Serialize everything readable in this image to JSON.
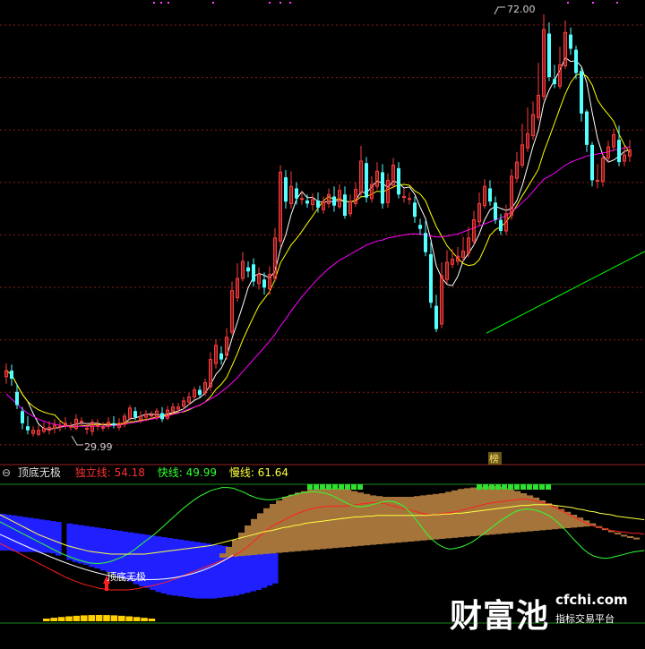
{
  "price_panel": {
    "high_label": "72.00",
    "low_label": "29.99",
    "bang_label": "榜"
  },
  "indicator": {
    "name": "顶底无极",
    "indep_label": "独立线: 54.18",
    "fast_label": "快线: 49.99",
    "slow_label": "慢线: 61.64",
    "signal_text": "顶底无极"
  },
  "watermark": {
    "brand": "财富池",
    "url": "cfchi.com",
    "tagline": "指标交易平台"
  },
  "colors": {
    "background": "#000000",
    "up_candle": "#ff3c3c",
    "down_candle": "#54ffff",
    "ma5": "#ffffff",
    "ma10": "#ffff00",
    "ma20": "#ff00ff",
    "ma60": "#00ff00",
    "blue_fill": "#2020ff",
    "brown_fill": "#a5743a",
    "indep_line": "#ff2020",
    "fast_line": "#30ff30",
    "slow_line": "#ffff40"
  },
  "chart_data": {
    "type": "candlestick",
    "y_high": 72.0,
    "y_low": 29.99,
    "candles": [
      [
        36.2,
        36.8,
        37.5,
        35.5
      ],
      [
        36.8,
        36.0,
        37.4,
        35.3
      ],
      [
        34.7,
        33.4,
        35.5,
        33.0
      ],
      [
        32.8,
        31.6,
        33.2,
        31.0
      ],
      [
        31.3,
        30.9,
        32.3,
        30.5
      ],
      [
        30.6,
        30.9,
        31.3,
        30.3
      ],
      [
        30.5,
        30.9,
        31.4,
        30.3
      ],
      [
        30.8,
        31.1,
        31.7,
        30.6
      ],
      [
        30.9,
        31.2,
        31.8,
        30.5
      ],
      [
        31.1,
        31.4,
        32.0,
        30.6
      ],
      [
        31.3,
        31.3,
        31.9,
        30.8
      ],
      [
        31.4,
        31.6,
        32.2,
        31.0
      ],
      [
        31.3,
        31.3,
        31.7,
        30.9
      ],
      [
        31.1,
        32.0,
        32.5,
        30.9
      ],
      [
        31.7,
        31.8,
        32.2,
        31.3
      ],
      [
        31.1,
        31.1,
        31.6,
        30.5
      ],
      [
        30.8,
        31.7,
        32.0,
        30.4
      ],
      [
        31.4,
        31.4,
        32.0,
        30.9
      ],
      [
        31.2,
        31.2,
        31.7,
        30.8
      ],
      [
        31.3,
        31.7,
        32.2,
        31.0
      ],
      [
        31.6,
        31.4,
        32.3,
        31.1
      ],
      [
        31.2,
        31.6,
        32.1,
        30.9
      ],
      [
        31.5,
        32.3,
        32.6,
        31.2
      ],
      [
        32.1,
        33.1,
        33.4,
        31.9
      ],
      [
        32.8,
        32.2,
        33.2,
        31.9
      ],
      [
        32.0,
        32.3,
        32.8,
        31.6
      ],
      [
        32.2,
        32.5,
        32.9,
        31.8
      ],
      [
        32.4,
        32.4,
        32.8,
        32.0
      ],
      [
        32.2,
        32.8,
        33.1,
        31.9
      ],
      [
        32.6,
        32.0,
        33.2,
        31.7
      ],
      [
        32.1,
        32.9,
        33.3,
        31.9
      ],
      [
        32.8,
        33.2,
        33.6,
        32.4
      ],
      [
        33.0,
        33.2,
        33.6,
        32.7
      ],
      [
        33.3,
        33.8,
        34.2,
        33.0
      ],
      [
        33.7,
        34.2,
        34.6,
        33.4
      ],
      [
        34.2,
        34.9,
        35.2,
        33.9
      ],
      [
        34.9,
        34.4,
        35.3,
        34.1
      ],
      [
        34.6,
        35.6,
        36.0,
        34.3
      ],
      [
        35.2,
        37.9,
        38.6,
        34.8
      ],
      [
        37.5,
        39.3,
        39.9,
        37.0
      ],
      [
        38.5,
        37.9,
        39.2,
        37.4
      ],
      [
        38.3,
        40.1,
        41.0,
        37.9
      ],
      [
        40.6,
        44.7,
        45.6,
        40.3
      ],
      [
        44.0,
        45.9,
        47.4,
        43.6
      ],
      [
        45.9,
        47.6,
        48.5,
        45.6
      ],
      [
        47.0,
        46.6,
        47.6,
        46.0
      ],
      [
        47.3,
        45.6,
        47.9,
        45.1
      ],
      [
        45.4,
        46.3,
        47.0,
        44.8
      ],
      [
        45.8,
        45.0,
        46.5,
        44.3
      ],
      [
        44.9,
        46.3,
        47.1,
        44.3
      ],
      [
        45.9,
        49.9,
        50.9,
        45.6
      ],
      [
        49.6,
        56.4,
        57.1,
        49.0
      ],
      [
        55.9,
        53.5,
        56.6,
        52.8
      ],
      [
        53.3,
        55.0,
        56.5,
        52.8
      ],
      [
        54.8,
        53.8,
        55.4,
        53.2
      ],
      [
        53.8,
        53.8,
        54.5,
        53.2
      ],
      [
        53.6,
        53.3,
        54.2,
        52.9
      ],
      [
        53.2,
        53.7,
        54.3,
        52.6
      ],
      [
        53.6,
        52.9,
        54.4,
        52.4
      ],
      [
        52.7,
        53.5,
        54.0,
        52.3
      ],
      [
        53.3,
        54.2,
        54.8,
        52.9
      ],
      [
        54.0,
        53.1,
        55.0,
        52.5
      ],
      [
        53.0,
        54.6,
        55.2,
        52.8
      ],
      [
        54.2,
        52.1,
        55.0,
        51.8
      ],
      [
        52.3,
        53.5,
        54.2,
        52.0
      ],
      [
        53.3,
        54.7,
        55.4,
        53.0
      ],
      [
        54.4,
        57.5,
        59.0,
        54.0
      ],
      [
        57.3,
        53.9,
        57.9,
        53.4
      ],
      [
        53.8,
        55.2,
        56.0,
        53.4
      ],
      [
        55.0,
        56.5,
        57.4,
        54.7
      ],
      [
        56.4,
        53.3,
        57.2,
        52.8
      ],
      [
        53.4,
        55.6,
        56.3,
        52.9
      ],
      [
        55.1,
        57.1,
        57.8,
        54.8
      ],
      [
        56.8,
        54.2,
        57.4,
        53.8
      ],
      [
        54.0,
        54.0,
        54.8,
        53.4
      ],
      [
        53.8,
        53.8,
        54.4,
        53.2
      ],
      [
        53.4,
        52.0,
        54.0,
        51.4
      ],
      [
        51.2,
        50.8,
        51.8,
        50.2
      ],
      [
        50.4,
        48.5,
        51.6,
        48.1
      ],
      [
        48.3,
        43.5,
        49.5,
        43.0
      ],
      [
        43.2,
        40.9,
        44.3,
        40.6
      ],
      [
        41.4,
        46.2,
        47.5,
        41.0
      ],
      [
        45.8,
        47.5,
        48.7,
        45.4
      ],
      [
        47.3,
        47.8,
        48.8,
        46.9
      ],
      [
        47.6,
        48.1,
        49.0,
        47.2
      ],
      [
        48.0,
        48.6,
        50.0,
        47.6
      ],
      [
        48.4,
        49.9,
        51.0,
        48.0
      ],
      [
        49.6,
        51.7,
        52.6,
        49.2
      ],
      [
        51.5,
        53.3,
        54.4,
        51.1
      ],
      [
        53.1,
        55.0,
        55.7,
        52.8
      ],
      [
        54.8,
        53.5,
        55.6,
        53.1
      ],
      [
        53.4,
        51.7,
        54.0,
        51.3
      ],
      [
        51.7,
        50.6,
        52.3,
        50.2
      ],
      [
        50.6,
        52.3,
        53.2,
        50.2
      ],
      [
        52.1,
        56.0,
        56.7,
        51.7
      ],
      [
        55.8,
        57.4,
        58.4,
        55.4
      ],
      [
        57.1,
        59.1,
        61.2,
        56.8
      ],
      [
        58.8,
        60.2,
        62.8,
        58.4
      ],
      [
        60.0,
        62.1,
        63.4,
        59.6
      ],
      [
        61.8,
        64.0,
        67.2,
        61.5
      ],
      [
        63.9,
        70.5,
        72.0,
        63.5
      ],
      [
        70.1,
        65.8,
        71.2,
        65.4
      ],
      [
        65.6,
        65.1,
        67.0,
        64.7
      ],
      [
        64.9,
        67.0,
        68.8,
        64.6
      ],
      [
        66.9,
        70.2,
        71.4,
        66.6
      ],
      [
        70.0,
        68.6,
        70.7,
        68.0
      ],
      [
        68.5,
        66.2,
        68.9,
        65.6
      ],
      [
        66.4,
        62.2,
        66.8,
        61.4
      ],
      [
        62.4,
        59.1,
        62.6,
        58.4
      ],
      [
        59.1,
        55.6,
        59.4,
        55.0
      ],
      [
        55.6,
        55.6,
        57.2,
        54.8
      ],
      [
        55.5,
        57.8,
        58.2,
        55.0
      ],
      [
        57.8,
        58.9,
        59.5,
        57.4
      ],
      [
        58.9,
        60.1,
        60.7,
        58.5
      ],
      [
        59.6,
        57.4,
        61.0,
        57.0
      ],
      [
        57.5,
        58.1,
        59.0,
        57.0
      ],
      [
        58.0,
        58.6,
        59.6,
        57.4
      ]
    ],
    "ma20": [
      34.5,
      34.0,
      33.5,
      33.0,
      32.6,
      32.3,
      32.0,
      31.8,
      31.6,
      31.5,
      31.4,
      31.3,
      31.3,
      31.3,
      31.3,
      31.3,
      31.3,
      31.3,
      31.3,
      31.3,
      31.4,
      31.4,
      31.5,
      31.6,
      31.7,
      31.8,
      31.9,
      32.0,
      32.1,
      32.2,
      32.3,
      32.5,
      32.6,
      32.8,
      33.0,
      33.2,
      33.4,
      33.7,
      34.0,
      34.3,
      34.7,
      35.1,
      35.6,
      36.1,
      36.7,
      37.3,
      37.9,
      38.5,
      39.1,
      39.7,
      40.4,
      41.2,
      41.9,
      42.7,
      43.4,
      44.1,
      44.7,
      45.3,
      45.9,
      46.4,
      46.9,
      47.3,
      47.7,
      48.0,
      48.3,
      48.6,
      48.9,
      49.2,
      49.4,
      49.6,
      49.7,
      49.9,
      50.0,
      50.1,
      50.2,
      50.3,
      50.3,
      50.3,
      50.2,
      50.1,
      50.0,
      50.0,
      50.1,
      50.2,
      50.3,
      50.5,
      50.7,
      50.9,
      51.1,
      51.3,
      51.5,
      51.7,
      51.9,
      52.1,
      52.5,
      52.9,
      53.4,
      53.9,
      54.5,
      55.1,
      55.7,
      56.0,
      56.3,
      56.7,
      57.1,
      57.4,
      57.6,
      57.8,
      58.0,
      58.1,
      58.2,
      58.3,
      58.4,
      58.6,
      58.7,
      58.8,
      58.9
    ],
    "ma60_tail": [
      40.5,
      41.4,
      42.3,
      43.2,
      44.1,
      45.0,
      45.9,
      46.8,
      47.7,
      48.6
    ],
    "indicator_series": {
      "blue_histogram": [
        0.1,
        0.1,
        0.09,
        0.08,
        0.08,
        0.08,
        0.08,
        0.07,
        0.07,
        0.06,
        0.03,
        0.0,
        -0.03,
        -0.06,
        -0.08,
        -0.1,
        -0.13,
        -0.15,
        -0.18,
        -0.2,
        -0.23,
        -0.27,
        -0.3,
        -0.33,
        -0.37,
        -0.4,
        -0.42,
        -0.45,
        -0.48,
        -0.5,
        -0.52,
        -0.53,
        -0.54,
        -0.55,
        -0.56,
        -0.57,
        -0.57,
        -0.57,
        -0.57,
        -0.56,
        -0.55,
        -0.54,
        -0.53,
        -0.51,
        -0.49,
        -0.47,
        -0.45,
        -0.42,
        -0.39,
        -0.36
      ],
      "brown_histogram": [
        0.0,
        0.0,
        0.0,
        0.0,
        0.0,
        0.0,
        0.0,
        0.0,
        0.0,
        0.0,
        0.0,
        0.0,
        0.0,
        0.0,
        0.0,
        0.0,
        0.0,
        0.0,
        0.0,
        0.0,
        0.0,
        0.0,
        0.0,
        0.0,
        0.0,
        0.0,
        0.0,
        0.0,
        0.0,
        0.0,
        0.0,
        0.0,
        0.0,
        0.0,
        0.0,
        0.0,
        0.0,
        0.0,
        0.0,
        0.0,
        0.0,
        0.0,
        0.0,
        0.0,
        0.0,
        0.0,
        0.0,
        0.0,
        0.0,
        0.0,
        0.06,
        0.15,
        0.25,
        0.35,
        0.45,
        0.54,
        0.62,
        0.69,
        0.75,
        0.8,
        0.85,
        0.88,
        0.91,
        0.93,
        0.95,
        0.96,
        0.97,
        0.97,
        0.97,
        0.96,
        0.95,
        0.93,
        0.91,
        0.89,
        0.87,
        0.86,
        0.85,
        0.85,
        0.85,
        0.85,
        0.85,
        0.86,
        0.87,
        0.88,
        0.89,
        0.9,
        0.92,
        0.94,
        0.96,
        0.97,
        0.98,
        0.99,
        1.0,
        1.0,
        0.99,
        0.97,
        0.95,
        0.93,
        0.9,
        0.87,
        0.84,
        0.8,
        0.76,
        0.72,
        0.68,
        0.64,
        0.6,
        0.56,
        0.52,
        0.48,
        0.44,
        0.41,
        0.38,
        0.35,
        0.32,
        0.3,
        0.28
      ],
      "indep_line": [
        0.2,
        0.16,
        0.12,
        0.08,
        0.04,
        0.0,
        -0.04,
        -0.08,
        -0.12,
        -0.16,
        -0.2,
        -0.24,
        -0.28,
        -0.31,
        -0.34,
        -0.37,
        -0.39,
        -0.41,
        -0.43,
        -0.44,
        -0.45,
        -0.45,
        -0.45,
        -0.45,
        -0.44,
        -0.43,
        -0.41,
        -0.4,
        -0.38,
        -0.36,
        -0.34,
        -0.31,
        -0.28,
        -0.25,
        -0.22,
        -0.19,
        -0.16,
        -0.13,
        -0.1,
        -0.07,
        -0.04,
        -0.01,
        0.03,
        0.07,
        0.12,
        0.18,
        0.25,
        0.32,
        0.38,
        0.44,
        0.48,
        0.52,
        0.56,
        0.6,
        0.63,
        0.66,
        0.68,
        0.7,
        0.71,
        0.72,
        0.72,
        0.72,
        0.72,
        0.73,
        0.74,
        0.75,
        0.76,
        0.77,
        0.77,
        0.76,
        0.74,
        0.72,
        0.7,
        0.68,
        0.66,
        0.64,
        0.62,
        0.6,
        0.6,
        0.61,
        0.62,
        0.63,
        0.64,
        0.66,
        0.68,
        0.7,
        0.72,
        0.74,
        0.76,
        0.77,
        0.78,
        0.79,
        0.8,
        0.81,
        0.82,
        0.82,
        0.8,
        0.78,
        0.76,
        0.73,
        0.7,
        0.66,
        0.62,
        0.58,
        0.54,
        0.5,
        0.47,
        0.44,
        0.42,
        0.4,
        0.38,
        0.37,
        0.36,
        0.35,
        0.34,
        0.34,
        0.33
      ],
      "fast_line": [
        0.5,
        0.46,
        0.42,
        0.38,
        0.34,
        0.3,
        0.26,
        0.22,
        0.18,
        0.14,
        0.1,
        0.06,
        0.03,
        0.0,
        -0.03,
        -0.05,
        -0.07,
        -0.08,
        -0.08,
        -0.07,
        -0.05,
        -0.02,
        0.01,
        0.05,
        0.1,
        0.16,
        0.22,
        0.28,
        0.34,
        0.41,
        0.48,
        0.55,
        0.62,
        0.69,
        0.75,
        0.81,
        0.86,
        0.9,
        0.94,
        0.96,
        0.98,
        0.98,
        0.97,
        0.94,
        0.91,
        0.87,
        0.84,
        0.82,
        0.81,
        0.81,
        0.82,
        0.84,
        0.86,
        0.88,
        0.9,
        0.91,
        0.92,
        0.92,
        0.91,
        0.89,
        0.86,
        0.82,
        0.78,
        0.74,
        0.72,
        0.71,
        0.72,
        0.74,
        0.76,
        0.78,
        0.79,
        0.78,
        0.75,
        0.7,
        0.62,
        0.52,
        0.42,
        0.32,
        0.24,
        0.18,
        0.14,
        0.12,
        0.13,
        0.15,
        0.18,
        0.22,
        0.27,
        0.33,
        0.39,
        0.45,
        0.51,
        0.56,
        0.61,
        0.65,
        0.67,
        0.68,
        0.67,
        0.65,
        0.62,
        0.58,
        0.52,
        0.45,
        0.37,
        0.28,
        0.2,
        0.12,
        0.06,
        0.02,
        0.0,
        -0.01,
        0.0,
        0.02,
        0.04,
        0.06,
        0.08,
        0.09,
        0.1
      ],
      "slow_line": [
        0.6,
        0.56,
        0.52,
        0.48,
        0.44,
        0.4,
        0.36,
        0.32,
        0.29,
        0.26,
        0.23,
        0.2,
        0.17,
        0.15,
        0.13,
        0.11,
        0.09,
        0.08,
        0.07,
        0.06,
        0.05,
        0.05,
        0.05,
        0.05,
        0.05,
        0.05,
        0.05,
        0.06,
        0.07,
        0.08,
        0.09,
        0.1,
        0.11,
        0.12,
        0.13,
        0.14,
        0.15,
        0.16,
        0.17,
        0.19,
        0.21,
        0.23,
        0.25,
        0.27,
        0.29,
        0.31,
        0.33,
        0.35,
        0.37,
        0.38,
        0.4,
        0.42,
        0.43,
        0.45,
        0.46,
        0.48,
        0.49,
        0.5,
        0.51,
        0.52,
        0.53,
        0.54,
        0.55,
        0.56,
        0.57,
        0.57,
        0.58,
        0.58,
        0.59,
        0.59,
        0.59,
        0.59,
        0.59,
        0.59,
        0.59,
        0.59,
        0.59,
        0.59,
        0.6,
        0.6,
        0.61,
        0.61,
        0.62,
        0.62,
        0.63,
        0.64,
        0.65,
        0.66,
        0.67,
        0.68,
        0.69,
        0.7,
        0.71,
        0.72,
        0.73,
        0.73,
        0.74,
        0.74,
        0.74,
        0.74,
        0.73,
        0.72,
        0.71,
        0.7,
        0.68,
        0.67,
        0.65,
        0.64,
        0.62,
        0.61,
        0.6,
        0.58,
        0.57,
        0.56,
        0.55,
        0.54,
        0.53
      ],
      "green_tops": [
        64,
        65,
        66,
        67,
        68,
        69,
        70,
        71,
        72,
        91,
        92,
        93,
        94,
        95,
        96,
        97,
        98,
        99,
        100,
        101,
        102
      ],
      "yellow_bottoms": [
        9,
        10,
        11,
        12,
        13,
        14,
        15,
        16,
        17,
        18,
        19,
        20,
        21,
        22,
        23
      ]
    }
  }
}
